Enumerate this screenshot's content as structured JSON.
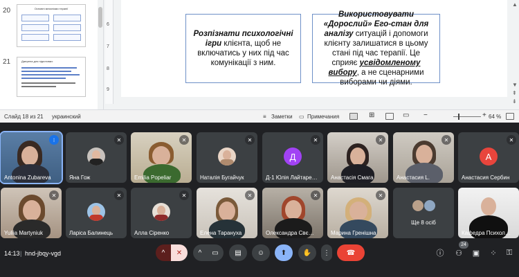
{
  "presentation": {
    "thumbnails": [
      {
        "number": "20",
        "title": "Основні механізми терапії"
      },
      {
        "number": "21",
        "title": "Джерела для підготовки:"
      }
    ],
    "ruler_numbers": [
      "6",
      "7",
      "8",
      "9"
    ],
    "slide": {
      "box1": {
        "part1": "Розпізнати психологічні ігри",
        "part2": " клієнта, щоб не включатись у них під час комунікації з ним."
      },
      "box2": {
        "part1": "Використовувати «Дорослий» Его-стан для аналізу",
        "part2": " ситуацій і допомоги клієнту залишатися в цьому стані під час терапії. Це сприяє ",
        "part3": "усвідомленому вибору",
        "part4": ", а не сценарними виборами чи діями."
      }
    },
    "status": {
      "slide_counter": "Слайд 18 из 21",
      "language": "украинский",
      "notes": "Заметки",
      "comments": "Примечания",
      "zoom": "64 %"
    }
  },
  "participants": [
    {
      "name": "Antonina Zubareva",
      "type": "photo",
      "active": true
    },
    {
      "name": "Яна Гож",
      "type": "avatar-photo"
    },
    {
      "name": "Emilia Popeliar",
      "type": "photo"
    },
    {
      "name": "Наталія Бугайчук",
      "type": "avatar-photo"
    },
    {
      "name": "Д-1 Юлія Лайтаре…",
      "type": "letter",
      "letter": "Д"
    },
    {
      "name": "Анастасія Смага",
      "type": "photo"
    },
    {
      "name": "Анастасия L.",
      "type": "photo"
    },
    {
      "name": "Анастасия Сербин",
      "type": "letter",
      "letter": "А"
    },
    {
      "name": "Yuliia Martyniuk",
      "type": "photo"
    },
    {
      "name": "Ларіса Балинець",
      "type": "avatar-photo"
    },
    {
      "name": "Алла Сіренко",
      "type": "avatar-photo"
    },
    {
      "name": "Елена Тарануха",
      "type": "photo"
    },
    {
      "name": "Олександра Свє…",
      "type": "photo"
    },
    {
      "name": "Марина Гренішна",
      "type": "photo"
    },
    {
      "name": "Ще 8 осіб",
      "type": "others"
    },
    {
      "name": "Кафедра Психол…",
      "type": "photo"
    }
  ],
  "controls": {
    "time": "14:13",
    "meeting_code": "hnd-jbqy-vgd",
    "participants_count": "24"
  },
  "colors": {
    "accent": "#8ab4f8",
    "end_call": "#ea4335",
    "avatar_purple": "#a142f4",
    "avatar_orange": "#e8453c"
  }
}
